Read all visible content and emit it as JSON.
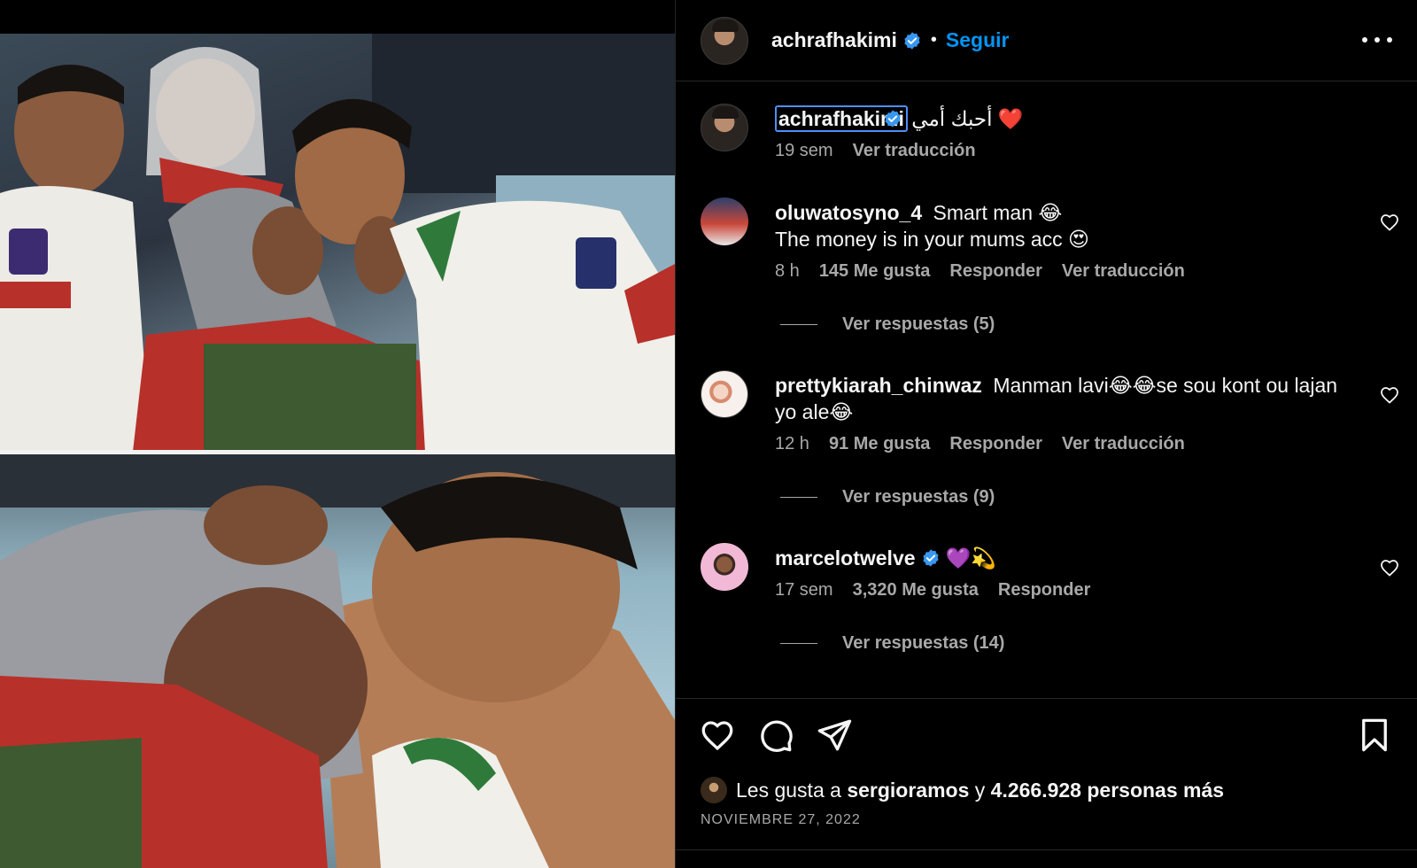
{
  "post": {
    "author": "achrafhakimi",
    "follow_label": "Seguir",
    "separator": "•"
  },
  "caption": {
    "username": "achrafhakimi",
    "text": "أحبك أمي",
    "emoji": "❤️",
    "age": "19 sem",
    "translate_label": "Ver traducción"
  },
  "comments": [
    {
      "username": "oluwatosyno_4",
      "text": "Smart man 😂",
      "text_line2": "The money is in your mums acc 😍",
      "age": "8 h",
      "likes": "145 Me gusta",
      "reply_label": "Responder",
      "translate_label": "Ver traducción",
      "replies_label": "Ver respuestas (5)"
    },
    {
      "username": "prettykiarah_chinwaz",
      "text": "Manman lavi😂😂se sou kont ou lajan yo ale😂",
      "age": "12 h",
      "likes": "91 Me gusta",
      "reply_label": "Responder",
      "translate_label": "Ver traducción",
      "replies_label": "Ver respuestas (9)"
    },
    {
      "username": "marcelotwelve",
      "text": "💜💫",
      "age": "17 sem",
      "likes": "3,320 Me gusta",
      "reply_label": "Responder",
      "replies_label": "Ver respuestas (14)"
    }
  ],
  "likes_summary": {
    "prefix": "Les gusta a",
    "user": "sergioramos",
    "joiner": "y",
    "rest": "4.266.928 personas más"
  },
  "date": "NOVIEMBRE 27, 2022",
  "icons": {
    "like": "heart-icon",
    "comment": "comment-bubble-icon",
    "share": "paper-plane-icon",
    "save": "bookmark-icon",
    "more": "ellipsis-icon",
    "verified": "verified-badge-icon"
  },
  "colors": {
    "background": "#000000",
    "link_blue": "#0095f6",
    "verified_blue": "#3897f0",
    "muted_text": "#a8a8a8"
  }
}
